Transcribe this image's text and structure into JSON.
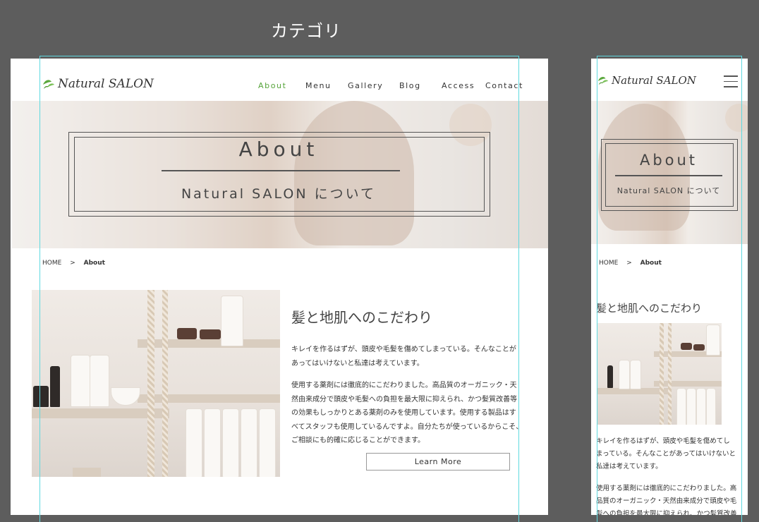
{
  "page_title": "カテゴリ",
  "desktop": {
    "logo": "Natural SALON",
    "nav": [
      "About",
      "Menu",
      "Gallery",
      "Blog",
      "Access",
      "Contact"
    ],
    "hero": {
      "title": "About",
      "subtitle": "Natural SALON について"
    },
    "breadcrumb": {
      "home": "HOME",
      "sep": ">",
      "current": "About"
    },
    "section": {
      "title": "髪と地肌へのこだわり",
      "p1_lines": [
        "キレイを作るはずが、頭皮や毛髪を傷めてしまっている。そんなことが",
        "あってはいけないと私達は考えています。"
      ],
      "p2_lines": [
        "使用する薬剤には徹底的にこだわりました。高品質のオーガニック・天",
        "然由来成分で頭皮や毛髪への負担を最大限に抑えられ、かつ髪質改善等",
        "の効果もしっかりとある薬剤のみを使用しています。使用する製品はす",
        "べてスタッフも使用しているんですよ。自分たちが使っているからこそ、",
        "ご相談にも的確に応じることができます。"
      ],
      "button": "Learn More"
    }
  },
  "mobile": {
    "logo": "Natural SALON",
    "hero": {
      "title": "About",
      "subtitle": "Natural SALON について"
    },
    "breadcrumb": {
      "home": "HOME",
      "sep": ">",
      "current": "About"
    },
    "section_title": "髪と地肌へのこだわり",
    "p1_lines": [
      "キレイを作るはずが、頭皮や毛髪を傷めてし",
      "まっている。そんなことがあってはいけないと",
      "私達は考えています。"
    ],
    "p2_lines": [
      "使用する薬剤には徹底的にこだわりました。高",
      "品質のオーガニック・天然由来成分で頭皮や毛",
      "髪への負担を最大限に抑えられ、かつ髪質改善"
    ]
  },
  "colors": {
    "accent": "#56a43a",
    "background": "#5d5d5d",
    "guide": "#5fd9e0"
  }
}
